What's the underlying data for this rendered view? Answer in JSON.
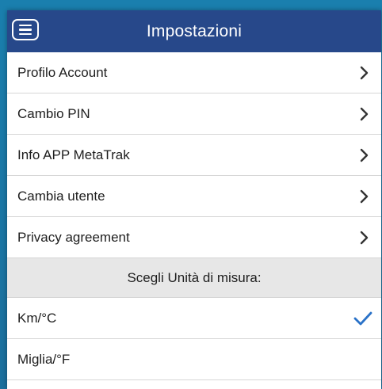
{
  "header": {
    "title": "Impostazioni",
    "menu_icon": "hamburger-menu-icon",
    "color": "#27488a"
  },
  "menu": [
    {
      "label": "Profilo Account",
      "icon": "chevron-right-icon"
    },
    {
      "label": "Cambio PIN",
      "icon": "chevron-right-icon"
    },
    {
      "label": "Info APP MetaTrak",
      "icon": "chevron-right-icon"
    },
    {
      "label": "Cambia utente",
      "icon": "chevron-right-icon"
    },
    {
      "label": "Privacy agreement",
      "icon": "chevron-right-icon"
    }
  ],
  "units": {
    "heading": "Scegli Unità di misura:",
    "options": [
      {
        "label": "Km/°C",
        "selected": true,
        "icon": "checkmark-icon"
      },
      {
        "label": "Miglia/°F",
        "selected": false
      }
    ],
    "check_color": "#2a72c8"
  }
}
